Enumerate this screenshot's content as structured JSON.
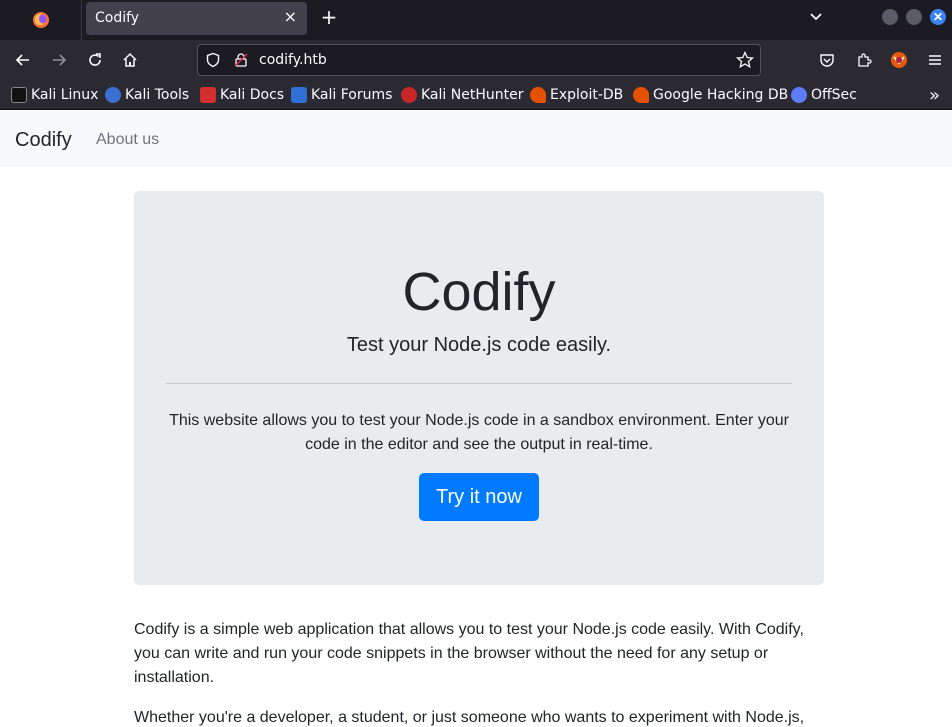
{
  "browser": {
    "tab_title": "Codify",
    "tab_close": "×",
    "new_tab": "+",
    "url": "codify.htb",
    "bookmarks": [
      {
        "label": "Kali Linux",
        "color": "#4a90e2"
      },
      {
        "label": "Kali Tools",
        "color": "#3b6fd4"
      },
      {
        "label": "Kali Docs",
        "color": "#d32f2f"
      },
      {
        "label": "Kali Forums",
        "color": "#2f6fd6"
      },
      {
        "label": "Kali NetHunter",
        "color": "#c62828"
      },
      {
        "label": "Exploit-DB",
        "color": "#e65100"
      },
      {
        "label": "Google Hacking DB",
        "color": "#e65100"
      },
      {
        "label": "OffSec",
        "color": "#5c7cfa"
      }
    ],
    "more_bookmarks": "»"
  },
  "site": {
    "brand": "Codify",
    "nav_about": "About us"
  },
  "hero": {
    "title": "Codify",
    "lead": "Test your Node.js code easily.",
    "description": "This website allows you to test your Node.js code in a sandbox environment. Enter your code in the editor and see the output in real-time.",
    "button": "Try it now"
  },
  "content": {
    "paragraph1": "Codify is a simple web application that allows you to test your Node.js code easily. With Codify, you can write and run your code snippets in the browser without the need for any setup or installation.",
    "paragraph2": "Whether you're a developer, a student, or just someone who wants to experiment with Node.js,"
  },
  "colors": {
    "primary": "#007bff",
    "jumbotron_bg": "#e9ecef",
    "navbar_bg": "#f8f9fa"
  }
}
